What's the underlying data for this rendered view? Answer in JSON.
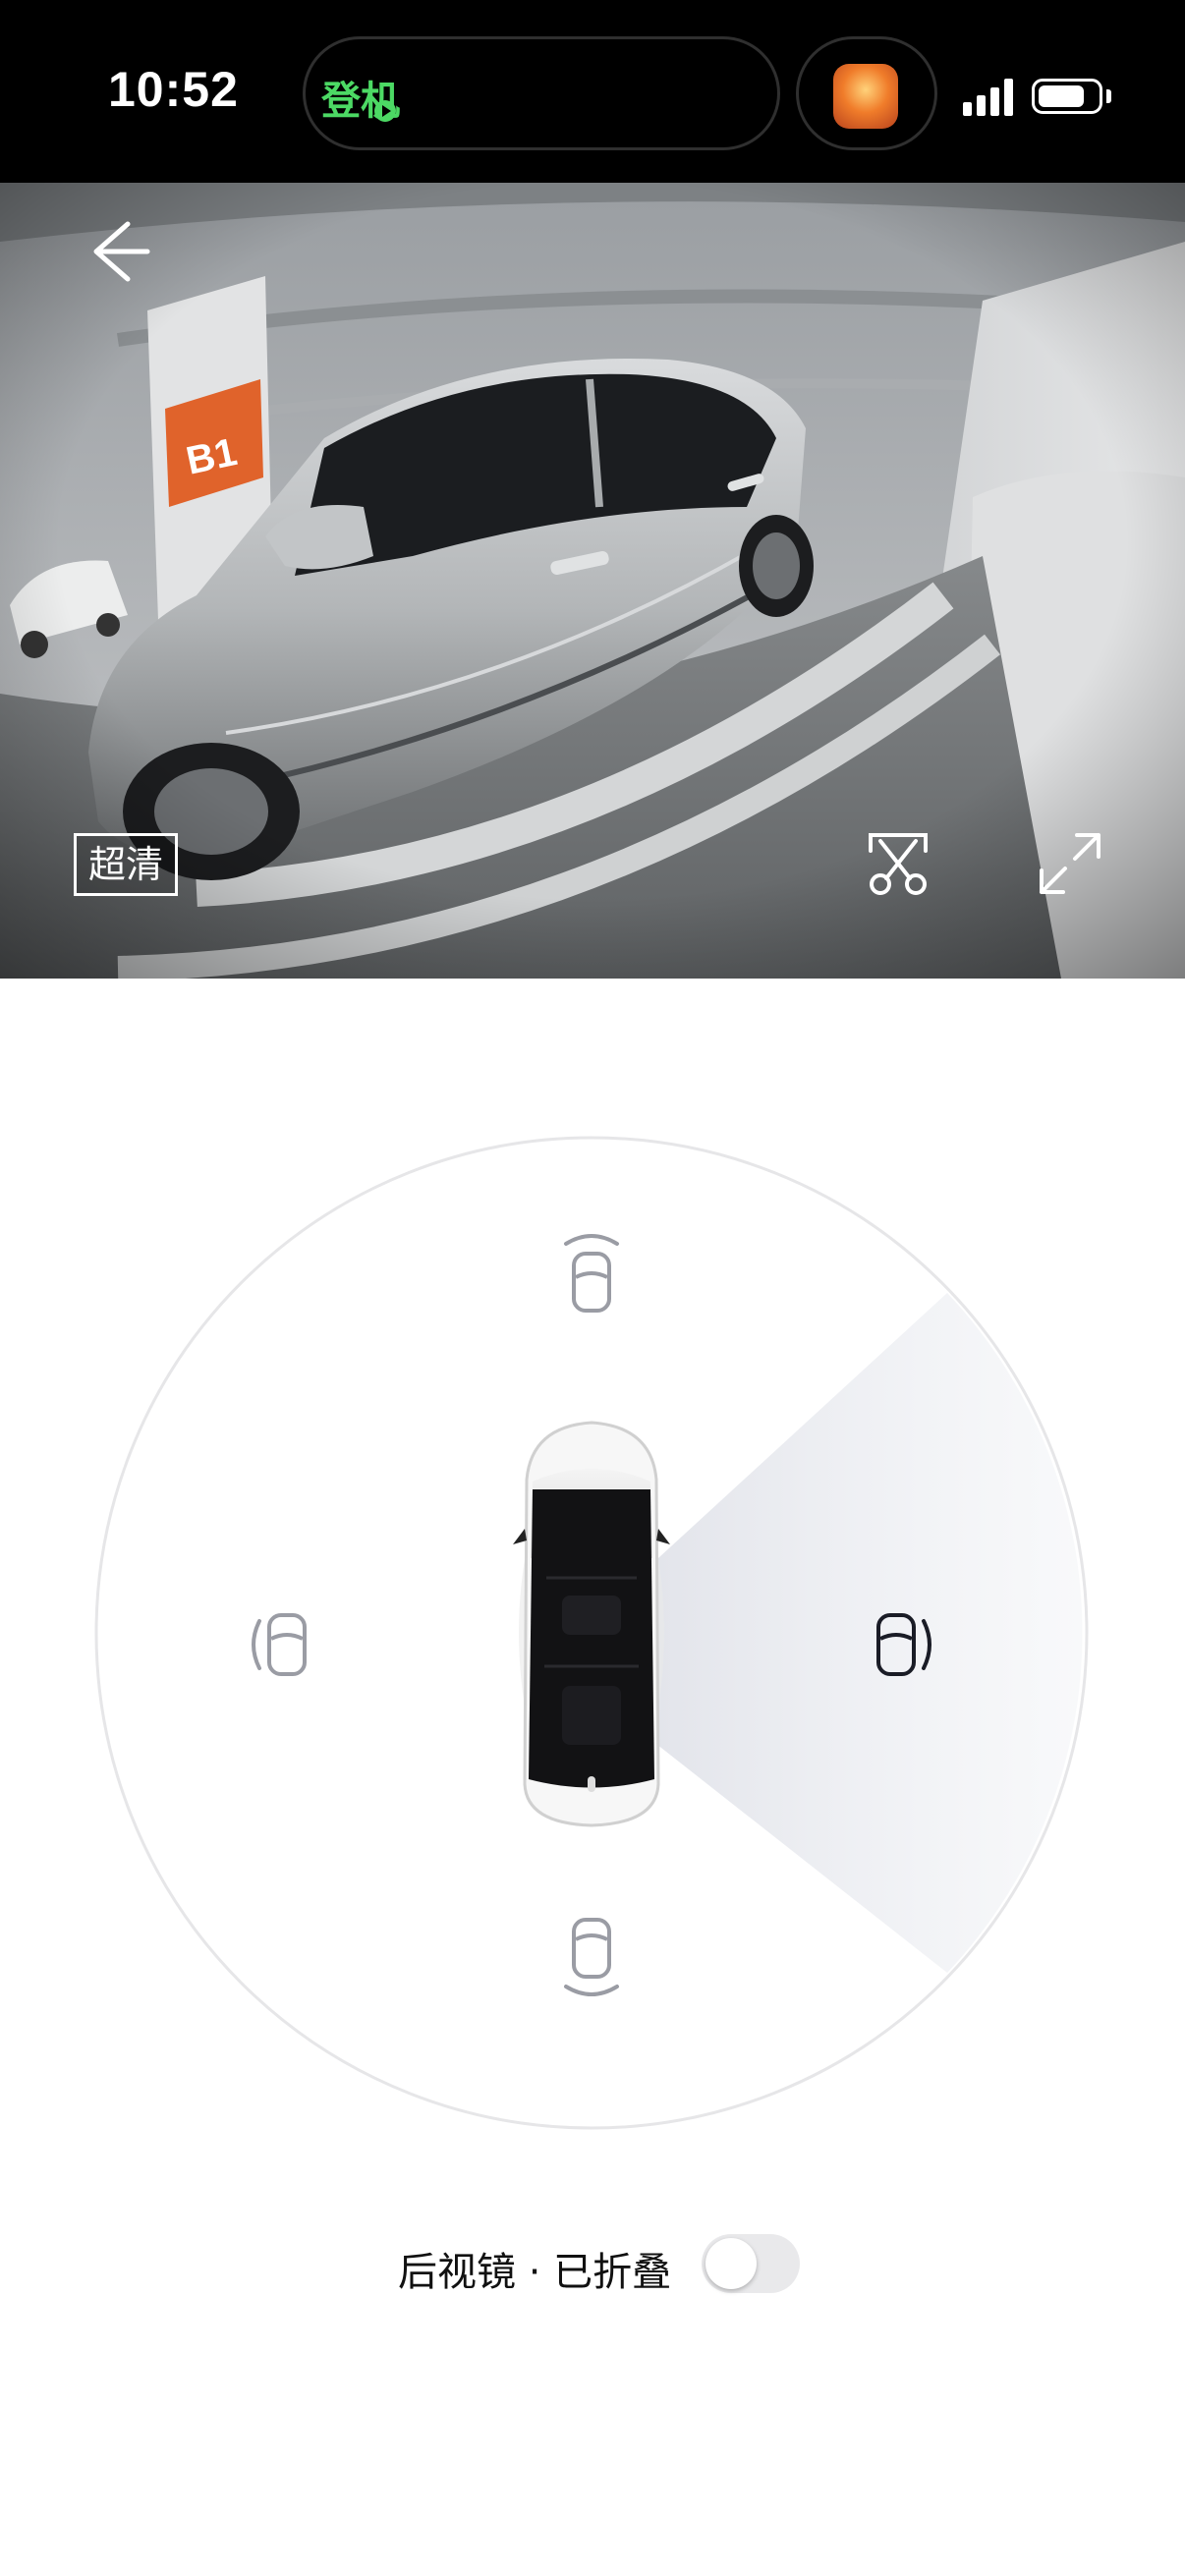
{
  "status_bar": {
    "time": "10:52",
    "live_activity_label": "登机",
    "battery_level": 0.8,
    "signal_bars": 4
  },
  "camera": {
    "quality_label": "超清",
    "back_icon": "arrow-left-icon",
    "scissor_icon": "scissor-capture-icon",
    "expand_icon": "fullscreen-expand-icon",
    "pillar_sign": "B1"
  },
  "view_selector": {
    "active_view": "right",
    "views": [
      {
        "id": "front",
        "icon": "camera-front-icon"
      },
      {
        "id": "left",
        "icon": "camera-left-icon"
      },
      {
        "id": "right",
        "icon": "camera-right-icon"
      },
      {
        "id": "rear",
        "icon": "camera-rear-icon"
      }
    ],
    "active_color": "#1a1c26",
    "inactive_color": "#9a9ca4"
  },
  "mirror": {
    "label": "后视镜 · 已折叠",
    "toggle_on": false
  }
}
